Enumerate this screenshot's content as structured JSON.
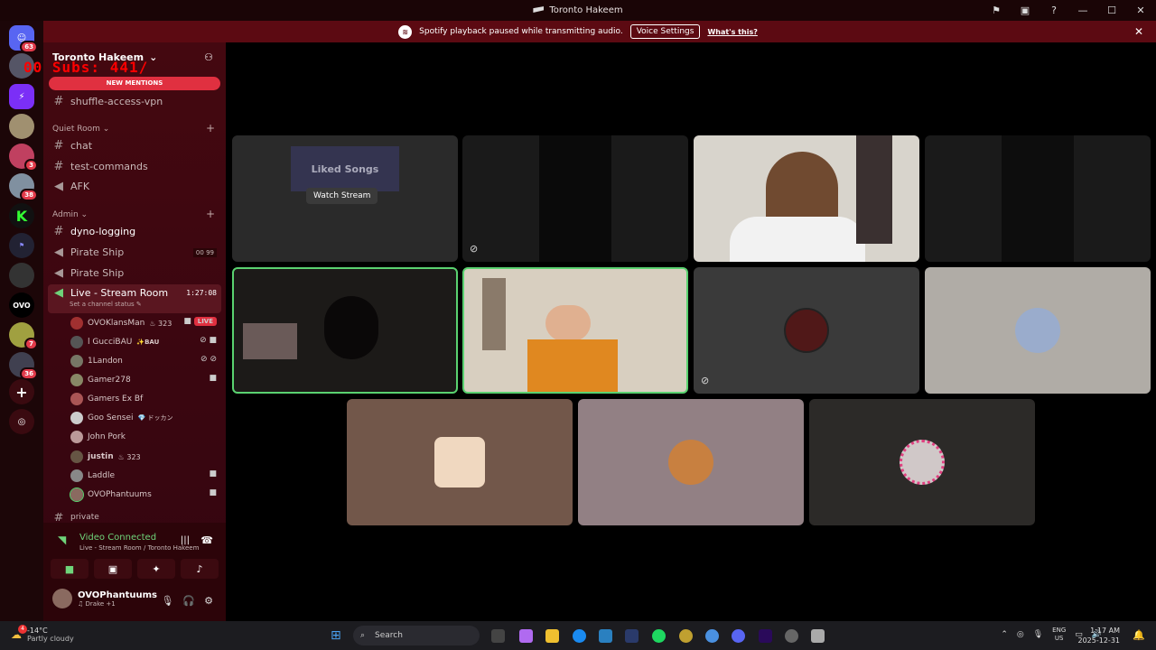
{
  "window": {
    "title": "Toronto Hakeem"
  },
  "banner": {
    "text": "Spotify playback paused while transmitting audio.",
    "button": "Voice Settings",
    "link": "What's this?"
  },
  "guilds": {
    "badges": [
      "63",
      "3",
      "38",
      "7",
      "36"
    ]
  },
  "overlay": {
    "subs": "00 Subs: 441/"
  },
  "sidebar": {
    "server_name": "Toronto Hakeem",
    "new_mentions": "NEW MENTIONS",
    "top_channel": "shuffle-access-vpn",
    "categories": [
      {
        "name": "Quiet Room",
        "channels": [
          "chat",
          "test-commands",
          "AFK"
        ]
      },
      {
        "name": "Admin",
        "channels": [
          "dyno-logging",
          "Pirate Ship",
          "Pirate Ship"
        ]
      }
    ],
    "pirate_count_a": "00",
    "pirate_count_b": "99",
    "live_channel": {
      "name": "Live - Stream Room",
      "timer": "1:27:08",
      "status": "Set a channel status"
    },
    "users": [
      {
        "name": "OVOKlansMan",
        "tag": "323",
        "live": "LIVE"
      },
      {
        "name": "l GucciBAU",
        "tag": "BAU"
      },
      {
        "name": "1Landon"
      },
      {
        "name": "Gamer278"
      },
      {
        "name": "Gamers Ex Bf"
      },
      {
        "name": "Goo Sensei",
        "tag": "ドッカン"
      },
      {
        "name": "John Pork"
      },
      {
        "name": "justin",
        "tag": "323"
      },
      {
        "name": "Laddle"
      },
      {
        "name": "OVOPhantuums"
      }
    ],
    "next_category": "private"
  },
  "voice_panel": {
    "title": "Video Connected",
    "subtitle": "Live - Stream Room / Toronto Hakeem"
  },
  "me": {
    "name": "OVOPhantuums",
    "status": "Drake +1"
  },
  "stage": {
    "watch_stream": "Watch Stream",
    "stream_title": "Liked Songs"
  },
  "taskbar": {
    "weather_badge": "4",
    "temp": "-14°C",
    "weather_desc": "Partly cloudy",
    "search": "Search",
    "lang": "ENG",
    "region": "US",
    "time": "1:17 AM",
    "date": "2025-12-31"
  },
  "colors": {
    "accent": "#e03040",
    "connected": "#6fd47a",
    "speaking": "#5ad270"
  }
}
